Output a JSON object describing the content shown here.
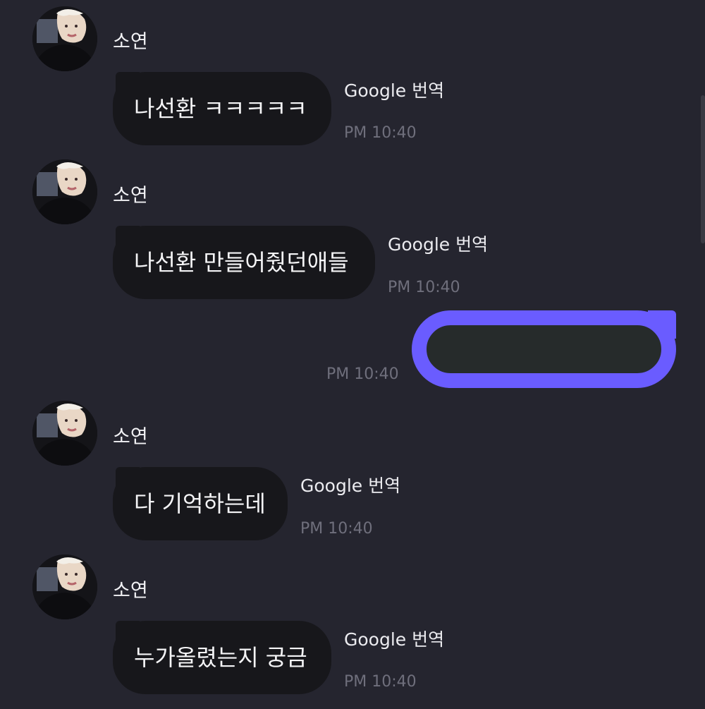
{
  "messages": [
    {
      "sender": "소연",
      "text": "나선환 ㅋㅋㅋㅋㅋ",
      "translate": "Google 번역",
      "time": "PM 10:40"
    },
    {
      "sender": "소연",
      "text": "나선환 만들어줬던애들",
      "translate": "Google 번역",
      "time": "PM 10:40"
    },
    {
      "sender": "소연",
      "text": "다 기억하는데",
      "translate": "Google 번역",
      "time": "PM 10:40"
    },
    {
      "sender": "소연",
      "text": "누가올렸는지 궁금",
      "translate": "Google 번역",
      "time": "PM 10:40"
    }
  ],
  "outgoing": {
    "time": "PM 10:40"
  },
  "colors": {
    "background": "#25252f",
    "incoming_bubble": "#17171b",
    "outgoing_bubble_border": "#6a5cff",
    "timestamp": "#6f6f7c"
  }
}
